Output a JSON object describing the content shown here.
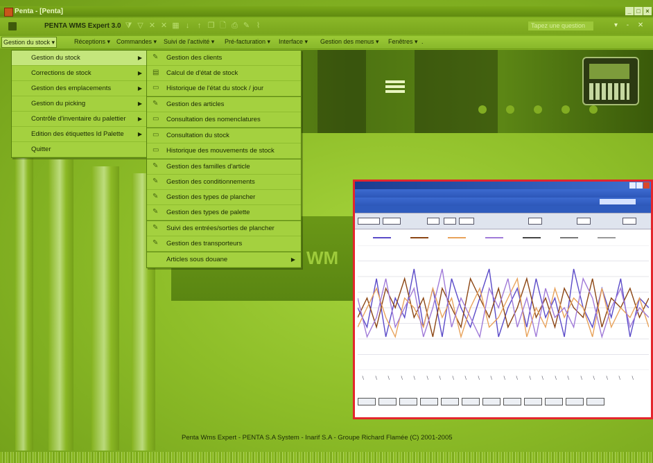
{
  "window": {
    "title": "Penta - [Penta]",
    "buttons": [
      "_",
      "□",
      "×"
    ]
  },
  "toolbar": {
    "product_name": "PENTA WMS Expert 3.0",
    "help_placeholder": "Tapez une question",
    "help_controls": "▾ - ✕"
  },
  "menubar": {
    "items": [
      "Gestion du stock ▾",
      "Réceptions ▾",
      "Commandes ▾",
      "Suivi de l'activité ▾",
      "Pré-facturation ▾",
      "Interface ▾",
      "Gestion des menus ▾",
      "Fenêtres ▾",
      "."
    ]
  },
  "menu_main": {
    "items": [
      {
        "label": "Gestion du stock",
        "submenu": true
      },
      {
        "label": "Corrections de stock",
        "submenu": true
      },
      {
        "label": "Gestion des emplacements",
        "submenu": true
      },
      {
        "label": "Gestion du picking",
        "submenu": true
      },
      {
        "label": "Contrôle d'inventaire du palettier",
        "submenu": true
      },
      {
        "label": "Edition des étiquettes Id Palette",
        "submenu": true
      },
      {
        "label": "Quitter",
        "submenu": false
      }
    ]
  },
  "menu_sub": {
    "items": [
      {
        "label": "Gestion des clients",
        "icon": "pencil-icon"
      },
      {
        "label": "Calcul de d'état de stock",
        "icon": "table-icon"
      },
      {
        "label": "Historique de l'état du stock / jour",
        "icon": "report-icon"
      },
      {
        "label": "Gestion des articles",
        "icon": "pencil-icon"
      },
      {
        "label": "Consultation des nomenclatures",
        "icon": "report-icon"
      },
      {
        "label": "Consultation du stock",
        "icon": "report-icon"
      },
      {
        "label": "Historique des mouvements de stock",
        "icon": "report-icon"
      },
      {
        "label": "Gestion des familles d'article",
        "icon": "pencil-icon"
      },
      {
        "label": "Gestion des conditionnements",
        "icon": "pencil-icon"
      },
      {
        "label": "Gestion des types de plancher",
        "icon": "pencil-icon"
      },
      {
        "label": "Gestion des types de palette",
        "icon": "pencil-icon"
      },
      {
        "label": "Suivi des entrées/sorties de plancher",
        "icon": "pencil-icon"
      },
      {
        "label": "Gestion des transporteurs",
        "icon": "pencil-icon"
      },
      {
        "label": "Articles sous douane",
        "icon": "",
        "submenu": true
      }
    ]
  },
  "center_block": {
    "text": "WM"
  },
  "footer": {
    "text": "Penta Wms Expert - PENTA S.A System - Inarif S.A - Groupe Richard Flamée (C) 2001-2005"
  },
  "colors": {
    "accent": "#a4d13f",
    "frame": "#e3262c",
    "background": "#8fbf2a"
  },
  "inset_chart": {
    "series": [
      {
        "color": "#5a4ac8",
        "values": [
          5,
          3,
          8,
          2,
          6,
          4,
          9,
          3,
          7,
          2,
          8,
          5,
          3,
          6,
          9,
          2,
          5,
          7,
          3,
          8,
          4,
          6,
          2,
          9,
          5,
          3,
          7,
          4,
          8,
          2,
          6,
          5
        ]
      },
      {
        "color": "#8b4513",
        "values": [
          4,
          6,
          3,
          7,
          5,
          8,
          4,
          6,
          2,
          7,
          5,
          3,
          8,
          6,
          4,
          7,
          3,
          5,
          8,
          4,
          6,
          3,
          7,
          5,
          4,
          8,
          3,
          6,
          5,
          7,
          4,
          6
        ]
      },
      {
        "color": "#e8a25a",
        "values": [
          3,
          5,
          7,
          4,
          2,
          6,
          5,
          3,
          7,
          4,
          6,
          2,
          5,
          7,
          3,
          4,
          6,
          8,
          2,
          5,
          3,
          7,
          4,
          6,
          5,
          2,
          7,
          3,
          5,
          4,
          6,
          3
        ]
      },
      {
        "color": "#a07ad8",
        "values": [
          6,
          2,
          4,
          8,
          3,
          5,
          7,
          2,
          5,
          9,
          3,
          6,
          4,
          2,
          7,
          5,
          8,
          3,
          6,
          2,
          7,
          4,
          5,
          3,
          8,
          6,
          2,
          5,
          7,
          3,
          5,
          4
        ]
      }
    ]
  }
}
